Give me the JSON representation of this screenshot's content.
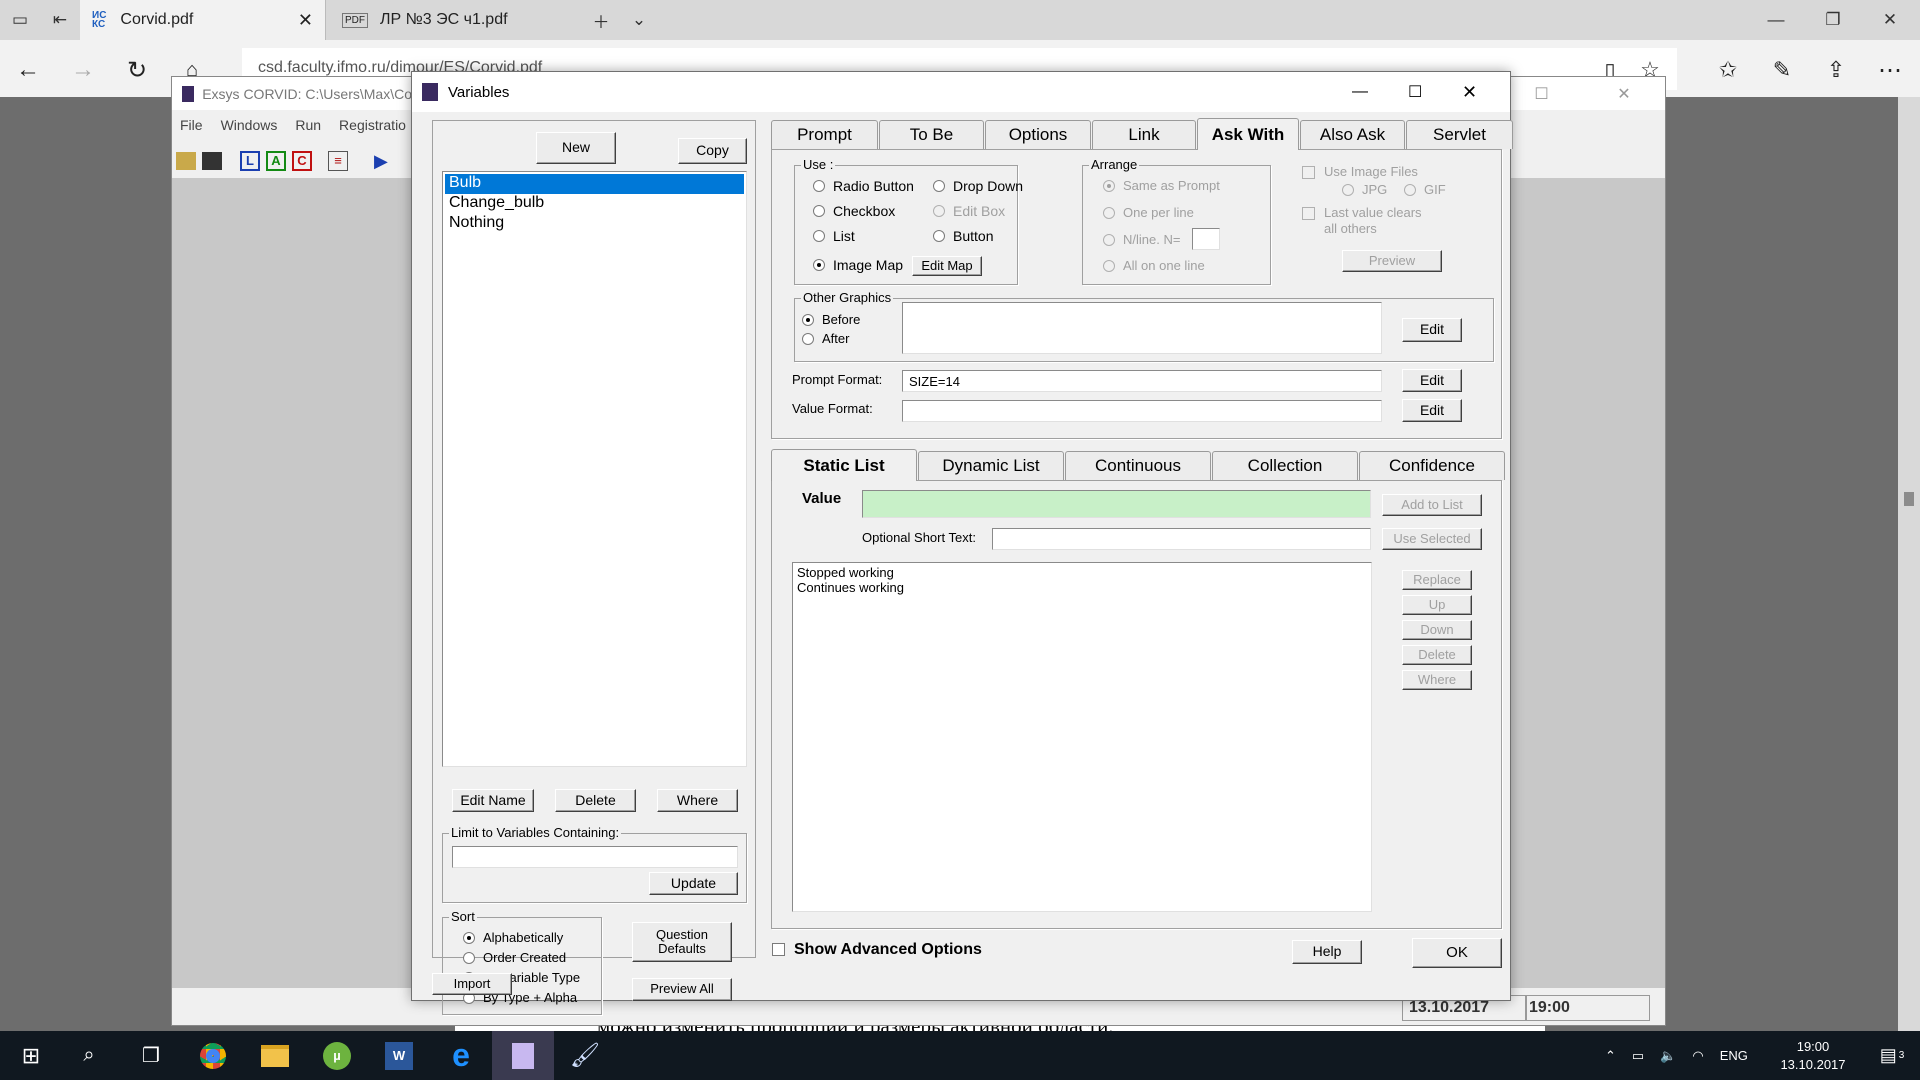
{
  "browser": {
    "tabs": [
      {
        "title": "Corvid.pdf",
        "icon": "ifmo-icon"
      },
      {
        "title": "ЛР №3 ЭС ч1.pdf",
        "icon": "pdf-icon"
      }
    ],
    "address": "csd.faculty.ifmo.ru/dimour/ES/Corvid.pdf",
    "document_text": "можно изменить пропорции и размеры активной области."
  },
  "background_app": {
    "title": "Exsys CORVID: C:\\Users\\Max\\Co",
    "menu": [
      "File",
      "Windows",
      "Run",
      "Registratio"
    ],
    "status_date": "13.10.2017",
    "status_time": "19:00"
  },
  "dialog": {
    "title": "Variables",
    "new_label": "New",
    "copy_label": "Copy",
    "variables": [
      "Bulb",
      "Change_bulb",
      "Nothing"
    ],
    "selected_index": 0,
    "edit_name_label": "Edit Name",
    "delete_label": "Delete",
    "where_label": "Where",
    "limit_label": "Limit to Variables Containing:",
    "limit_value": "",
    "update_label": "Update",
    "sort": {
      "label": "Sort",
      "options": [
        "Alphabetically",
        "Order Created",
        "By Variable Type",
        "By Type + Alpha"
      ],
      "selected": "Alphabetically"
    },
    "question_defaults_label": "Question\nDefaults",
    "preview_all_label": "Preview All",
    "import_label": "Import",
    "top_tabs": [
      "Prompt",
      "To Be",
      "Options",
      "Link",
      "Ask With",
      "Also Ask",
      "Servlet"
    ],
    "top_tab_selected": "Ask With",
    "use": {
      "label": "Use :",
      "options": [
        {
          "label": "Radio Button",
          "enabled": true,
          "checked": false
        },
        {
          "label": "Drop Down",
          "enabled": true,
          "checked": false
        },
        {
          "label": "Checkbox",
          "enabled": true,
          "checked": false
        },
        {
          "label": "Edit Box",
          "enabled": false,
          "checked": false
        },
        {
          "label": "List",
          "enabled": true,
          "checked": false
        },
        {
          "label": "Button",
          "enabled": true,
          "checked": false
        },
        {
          "label": "Image Map",
          "enabled": true,
          "checked": true
        }
      ],
      "edit_map_label": "Edit Map"
    },
    "arrange": {
      "label": "Arrange",
      "options": [
        "Same as Prompt",
        "One per line",
        "N/line. N=",
        "All on one line"
      ],
      "selected": "Same as Prompt",
      "n_value": ""
    },
    "use_image_files_label": "Use Image Files",
    "jpg_label": "JPG",
    "gif_label": "GIF",
    "last_value_clears_label": "Last value clears\nall others",
    "preview_label": "Preview",
    "other_graphics": {
      "label": "Other Graphics",
      "before_label": "Before",
      "after_label": "After",
      "selected": "Before",
      "edit_label": "Edit"
    },
    "prompt_format_label": "Prompt Format:",
    "prompt_format_value": "SIZE=14",
    "value_format_label": "Value Format:",
    "value_format_value": "",
    "edit_label": "Edit",
    "bottom_tabs": [
      "Static List",
      "Dynamic List",
      "Continuous",
      "Collection",
      "Confidence"
    ],
    "bottom_tab_selected": "Static List",
    "value_label": "Value",
    "value_input": "",
    "add_to_list_label": "Add to List",
    "short_text_label": "Optional Short Text:",
    "short_text_value": "",
    "use_selected_label": "Use Selected",
    "values": [
      "Stopped working",
      "Continues working"
    ],
    "replace_label": "Replace",
    "up_label": "Up",
    "down_label": "Down",
    "delete_value_label": "Delete",
    "where_value_label": "Where",
    "show_advanced_label": "Show Advanced Options",
    "help_label": "Help",
    "ok_label": "OK"
  },
  "taskbar": {
    "language": "ENG",
    "time": "19:00",
    "date": "13.10.2017",
    "notifications": "3"
  }
}
